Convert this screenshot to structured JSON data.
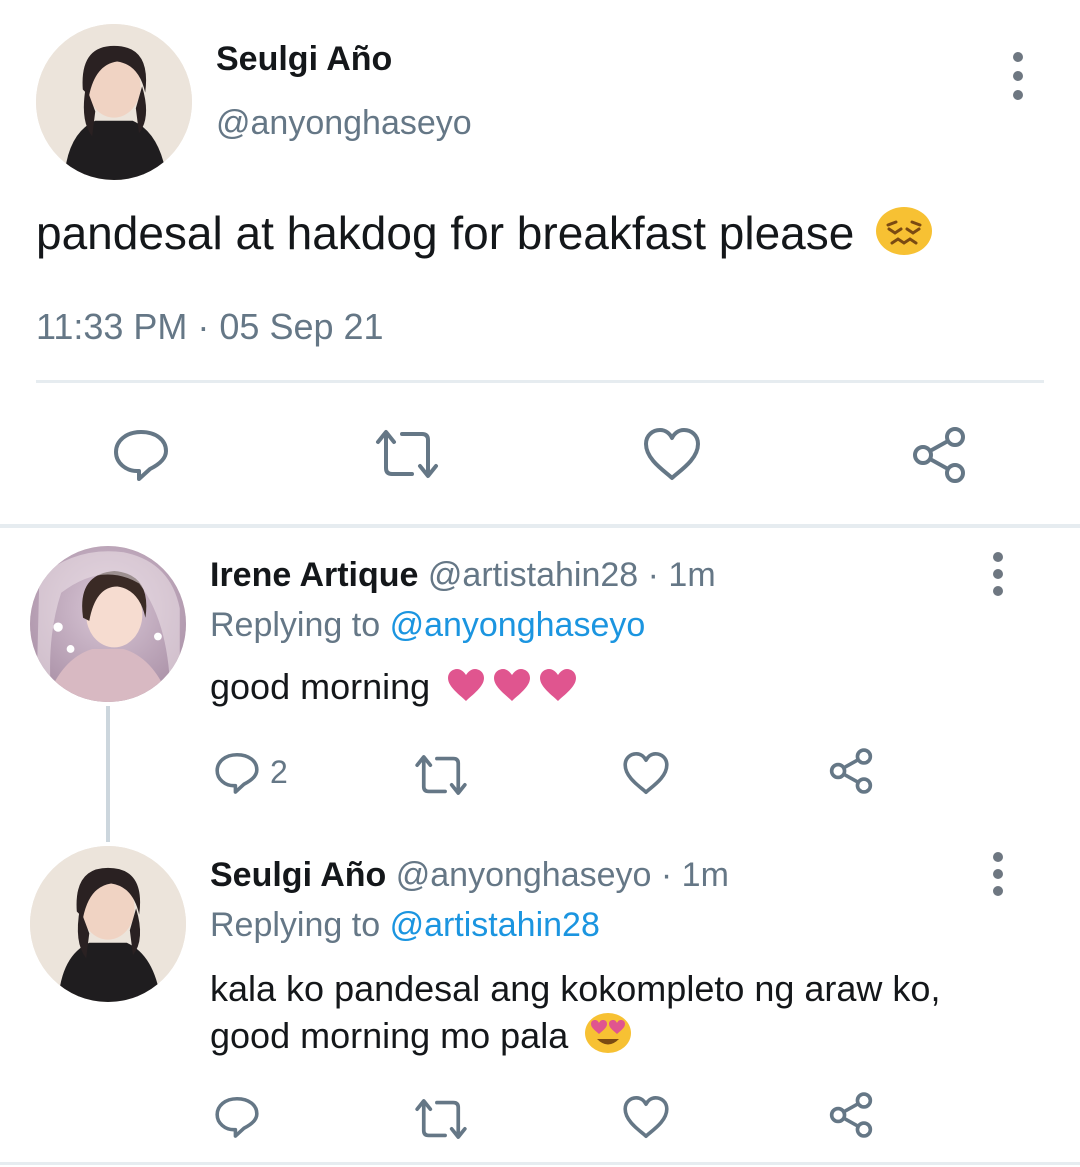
{
  "main_tweet": {
    "display_name": "Seulgi Año",
    "handle": "@anyonghaseyo",
    "text": "pandesal at hakdog for breakfast please",
    "text_emoji": "confounded-face",
    "timestamp": "11:33 PM · 05 Sep 21"
  },
  "replies": [
    {
      "display_name": "Irene Artique",
      "meta": "@artistahin28 · 1m",
      "replying_prefix": "Replying to",
      "replying_to": "@anyonghaseyo",
      "text": "good morning",
      "text_emoji": "three-pink-hearts",
      "reply_count": "2"
    },
    {
      "display_name": "Seulgi Año",
      "meta": "@anyonghaseyo · 1m",
      "replying_prefix": "Replying to",
      "replying_to": "@artistahin28",
      "text_line1": "kala ko pandesal ang kokompleto ng araw ko,",
      "text_line2": "good morning mo pala",
      "text_emoji": "heart-eyes-face"
    }
  ],
  "colors": {
    "link": "#1b95e0",
    "muted": "#657786",
    "icon": "#657786",
    "heart_emoji": "#e0558f",
    "emoji_face": "#f7c133"
  },
  "icons": [
    "reply-icon",
    "retweet-icon",
    "like-icon",
    "share-icon",
    "more-options-icon"
  ]
}
